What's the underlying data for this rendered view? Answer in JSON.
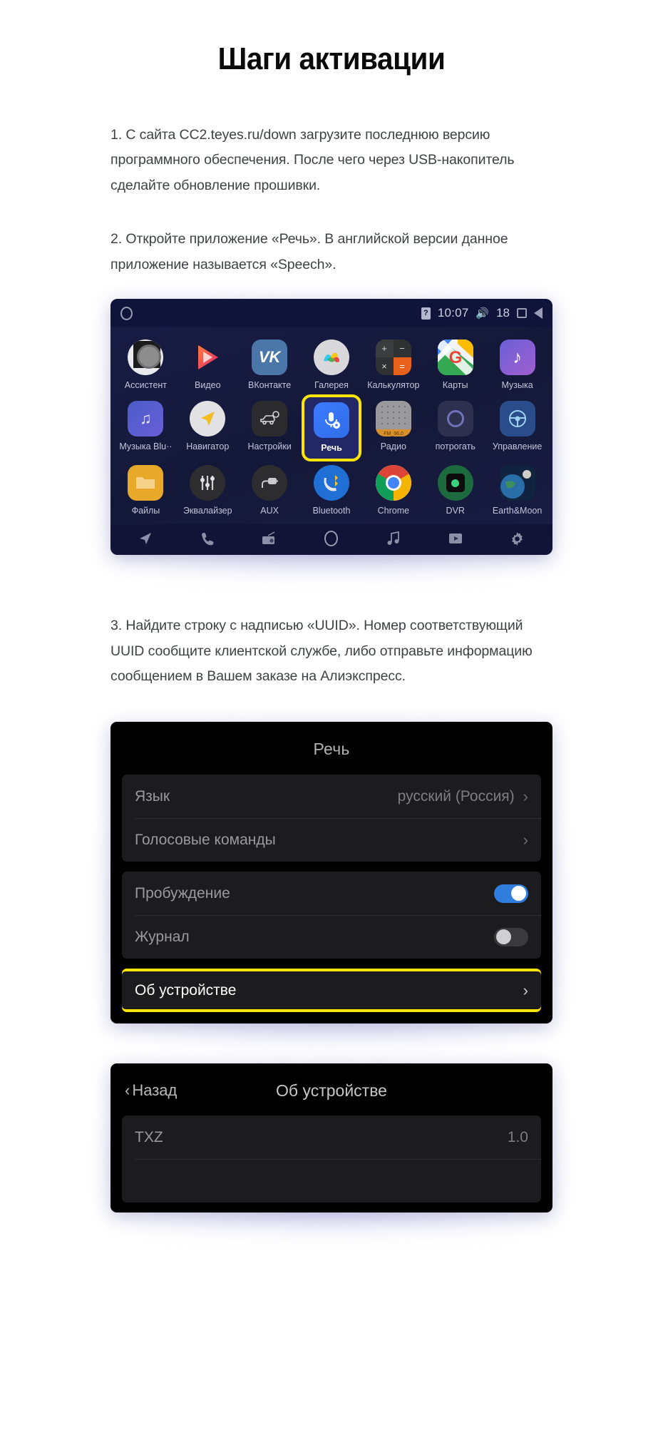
{
  "page": {
    "title": "Шаги активации"
  },
  "steps": {
    "step1": "1. С сайта CC2.teyes.ru/down загрузите последнюю версию программного обеспечения. После чего через USB-накопитель сделайте обновление прошивки.",
    "step2": "2. Откройте приложение «Речь». В английской версии данное приложение называется «Speech».",
    "step3": "3. Найдите строку с надписью «UUID». Номер соответствующий UUID сообщите клиентской службе, либо отправьте информацию сообщением в Вашем заказе на Алиэкспресс."
  },
  "launcher": {
    "statusbar": {
      "home_icon": "circle-icon",
      "sim_icon": "sim-card-icon",
      "time": "10:07",
      "volume_icon": "volume-icon",
      "volume_level": "18",
      "recents_icon": "square-icon",
      "back_icon": "triangle-back-icon"
    },
    "apps": [
      {
        "label": "Ассистент",
        "icon": "google-assistant-icon"
      },
      {
        "label": "Видео",
        "icon": "video-player-icon"
      },
      {
        "label": "ВКонтакте",
        "icon": "vk-icon"
      },
      {
        "label": "Галерея",
        "icon": "gallery-icon"
      },
      {
        "label": "Калькулятор",
        "icon": "calculator-icon"
      },
      {
        "label": "Карты",
        "icon": "google-maps-icon"
      },
      {
        "label": "Музыка",
        "icon": "music-icon"
      },
      {
        "label": "Музыка Blu··",
        "icon": "bluetooth-music-icon"
      },
      {
        "label": "Навигатор",
        "icon": "navigator-icon"
      },
      {
        "label": "Настройки",
        "icon": "car-settings-icon"
      },
      {
        "label": "Речь",
        "icon": "microphone-settings-icon",
        "highlighted": true
      },
      {
        "label": "Радио",
        "icon": "radio-icon"
      },
      {
        "label": "потрогать",
        "icon": "touch-icon"
      },
      {
        "label": "Управление",
        "icon": "steering-wheel-icon"
      },
      {
        "label": "Файлы",
        "icon": "folder-icon"
      },
      {
        "label": "Эквалайзер",
        "icon": "equalizer-icon"
      },
      {
        "label": "AUX",
        "icon": "aux-plug-icon"
      },
      {
        "label": "Bluetooth",
        "icon": "bluetooth-phone-icon"
      },
      {
        "label": "Chrome",
        "icon": "chrome-icon"
      },
      {
        "label": "DVR",
        "icon": "dvr-camera-icon"
      },
      {
        "label": "Earth&Moon",
        "icon": "earth-moon-icon"
      }
    ],
    "dock": [
      "navigation-arrow-icon",
      "phone-icon",
      "radio-icon",
      "home-circle-icon",
      "music-note-icon",
      "video-icon",
      "gear-icon"
    ]
  },
  "speech_settings": {
    "title": "Речь",
    "group1": [
      {
        "label": "Язык",
        "value": "русский (Россия)",
        "chevron": "›"
      },
      {
        "label": "Голосовые команды",
        "value": "",
        "chevron": "›"
      }
    ],
    "group2": [
      {
        "label": "Пробуждение",
        "toggle": "on"
      },
      {
        "label": "Журнал",
        "toggle": "off"
      }
    ],
    "about_row": {
      "label": "Об устройстве",
      "chevron": "›",
      "highlighted": true
    }
  },
  "about_device": {
    "back_label": "Назад",
    "back_icon": "chevron-left-icon",
    "title": "Об устройстве",
    "rows": [
      {
        "label": "TXZ",
        "value": "1.0"
      }
    ]
  },
  "colors": {
    "highlight": "#ffe500",
    "toggle_on": "#2f7ddd",
    "launcher_bg": "#141838",
    "settings_bg": "#000000"
  }
}
